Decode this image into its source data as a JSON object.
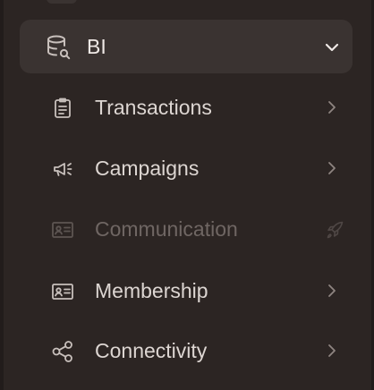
{
  "colors": {
    "background": "#2c2523",
    "active_section_bg": "#3a3331",
    "text": "#ddd6d2",
    "text_active": "#efe9e6",
    "text_disabled": "#6f6663",
    "icon": "#c8c0bc",
    "icon_disabled": "#5d5552"
  },
  "sidebar": {
    "section": {
      "label": "BI",
      "icon": "database-search-icon",
      "expanded": true
    },
    "items": [
      {
        "label": "Transactions",
        "icon": "clipboard-list-icon",
        "disabled": false,
        "trailing": "chevron-right-icon"
      },
      {
        "label": "Campaigns",
        "icon": "megaphone-icon",
        "disabled": false,
        "trailing": "chevron-right-icon"
      },
      {
        "label": "Communication",
        "icon": "id-card-icon",
        "disabled": true,
        "trailing": "rocket-icon"
      },
      {
        "label": "Membership",
        "icon": "id-card-icon",
        "disabled": false,
        "trailing": "chevron-right-icon"
      },
      {
        "label": "Connectivity",
        "icon": "share-nodes-icon",
        "disabled": false,
        "trailing": "chevron-right-icon"
      }
    ]
  }
}
